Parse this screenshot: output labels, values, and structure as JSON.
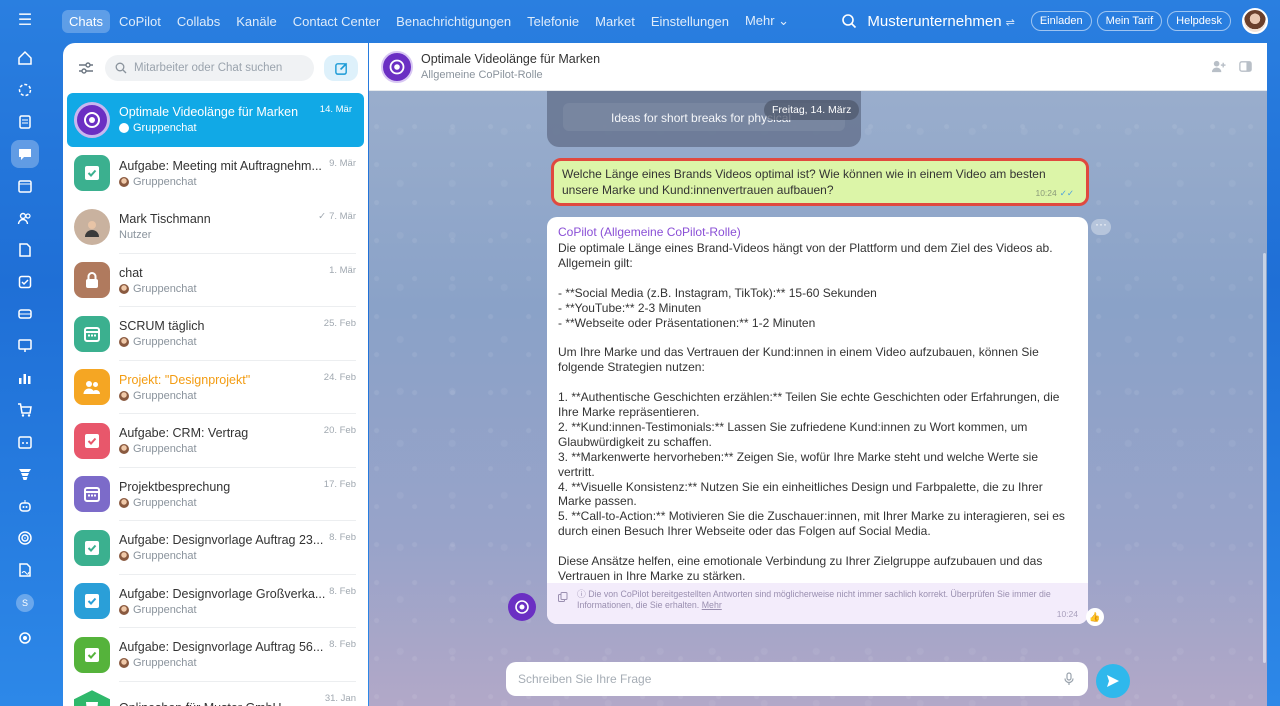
{
  "nav": {
    "tabs": [
      "Chats",
      "CoPilot",
      "Collabs",
      "Kanäle",
      "Contact Center",
      "Benachrichtigungen",
      "Telefonie",
      "Market",
      "Einstellungen",
      "Mehr ⌄"
    ],
    "company": "Musterunternehmen",
    "buttons": [
      "Einladen",
      "Mein Tarif",
      "Helpdesk"
    ]
  },
  "rail": {
    "user_letter": "S",
    "icons": [
      "home-icon",
      "copilot-icon",
      "feed-icon",
      "chat-icon",
      "calendar-icon",
      "contacts-icon",
      "docs-icon",
      "tasks-icon",
      "crm-icon",
      "presentation-icon",
      "analytics-icon",
      "shop-icon",
      "booking-icon",
      "funnel-icon",
      "robot-icon",
      "target-icon",
      "signature-icon",
      "settings-icon"
    ]
  },
  "search": {
    "placeholder": "Mitarbeiter oder Chat suchen"
  },
  "chats": [
    {
      "title": "Optimale Videolänge für Marken",
      "subtitle": "Gruppenchat",
      "date": "14. Mär",
      "icon": "copilot-icon",
      "color": "#6b2fc3"
    },
    {
      "title": "Aufgabe: Meeting mit Auftragnehm...",
      "subtitle": "Gruppenchat",
      "date": "9. Mär",
      "icon": "task-icon",
      "color": "#3bb08f"
    },
    {
      "title": "Mark Tischmann",
      "subtitle": "Nutzer",
      "date": "7. Mär",
      "icon": "user-avatar",
      "color": "#7a5a45"
    },
    {
      "title": "chat",
      "subtitle": "Gruppenchat",
      "date": "1. Mär",
      "icon": "lock-icon",
      "color": "#b07a5e"
    },
    {
      "title": "SCRUM täglich",
      "subtitle": "Gruppenchat",
      "date": "25. Feb",
      "icon": "calendar-icon",
      "color": "#3bb08f"
    },
    {
      "title": "Projekt: \"Designprojekt\"",
      "subtitle": "Gruppenchat",
      "date": "24. Feb",
      "icon": "group-icon",
      "color": "#f5a623"
    },
    {
      "title": "Aufgabe: CRM: Vertrag",
      "subtitle": "Gruppenchat",
      "date": "20. Feb",
      "icon": "task-icon",
      "color": "#e8576b"
    },
    {
      "title": "Projektbesprechung",
      "subtitle": "Gruppenchat",
      "date": "17. Feb",
      "icon": "calendar-icon",
      "color": "#7c6bc9"
    },
    {
      "title": "Aufgabe: Designvorlage Auftrag 23...",
      "subtitle": "Gruppenchat",
      "date": "8. Feb",
      "icon": "task-icon",
      "color": "#3bb08f"
    },
    {
      "title": "Aufgabe: Designvorlage Großverka...",
      "subtitle": "Gruppenchat",
      "date": "8. Feb",
      "icon": "task-icon",
      "color": "#2a9fd8"
    },
    {
      "title": "Aufgabe: Designvorlage Auftrag 56...",
      "subtitle": "Gruppenchat",
      "date": "8. Feb",
      "icon": "task-icon",
      "color": "#55b33b"
    },
    {
      "title": "Onlineshop für Muster GmbH",
      "subtitle": "",
      "date": "31. Jan",
      "icon": "shop-icon",
      "color": "#2fb86b"
    }
  ],
  "chat": {
    "title": "Optimale Videolänge für Marken",
    "subtitle": "Allgemeine CoPilot-Rolle",
    "prev_text": "Ideas for short breaks for physical",
    "date_chip": "Freitag, 14. März",
    "user_message": "Welche Länge eines Brands Videos optimal ist? Wie können wie in einem Video am besten unsere Marke und Kund:innenvertrauen aufbauen?",
    "user_time": "10:24",
    "bot_name": "CoPilot (Allgemeine CoPilot-Rolle)",
    "bot_message": "Die optimale Länge eines Brand-Videos hängt von der Plattform und dem Ziel des Videos ab. Allgemein gilt:\n\n- **Social Media (z.B. Instagram, TikTok):** 15-60 Sekunden\n- **YouTube:** 2-3 Minuten\n- **Webseite oder Präsentationen:** 1-2 Minuten\n\nUm Ihre Marke und das Vertrauen der Kund:innen in einem Video aufzubauen, können Sie folgende Strategien nutzen:\n\n1. **Authentische Geschichten erzählen:** Teilen Sie echte Geschichten oder Erfahrungen, die Ihre Marke repräsentieren.\n2. **Kund:innen-Testimonials:** Lassen Sie zufriedene Kund:innen zu Wort kommen, um Glaubwürdigkeit zu schaffen.\n3. **Markenwerte hervorheben:** Zeigen Sie, wofür Ihre Marke steht und welche Werte sie vertritt.\n4. **Visuelle Konsistenz:** Nutzen Sie ein einheitliches Design und Farbpalette, die zu Ihrer Marke passen.\n5. **Call-to-Action:** Motivieren Sie die Zuschauer:innen, mit Ihrer Marke zu interagieren, sei es durch einen Besuch Ihrer Webseite oder das Folgen auf Social Media.\n\nDiese Ansätze helfen, eine emotionale Verbindung zu Ihrer Zielgruppe aufzubauen und das Vertrauen in Ihre Marke zu stärken.",
    "disclaimer": "ⓘ Die von CoPilot bereitgestellten Antworten sind möglicherweise nicht immer sachlich korrekt. Überprüfen Sie immer die Informationen, die Sie erhalten.",
    "disclaimer_link": "Mehr",
    "bot_time": "10:24",
    "input_placeholder": "Schreiben Sie Ihre Frage"
  }
}
